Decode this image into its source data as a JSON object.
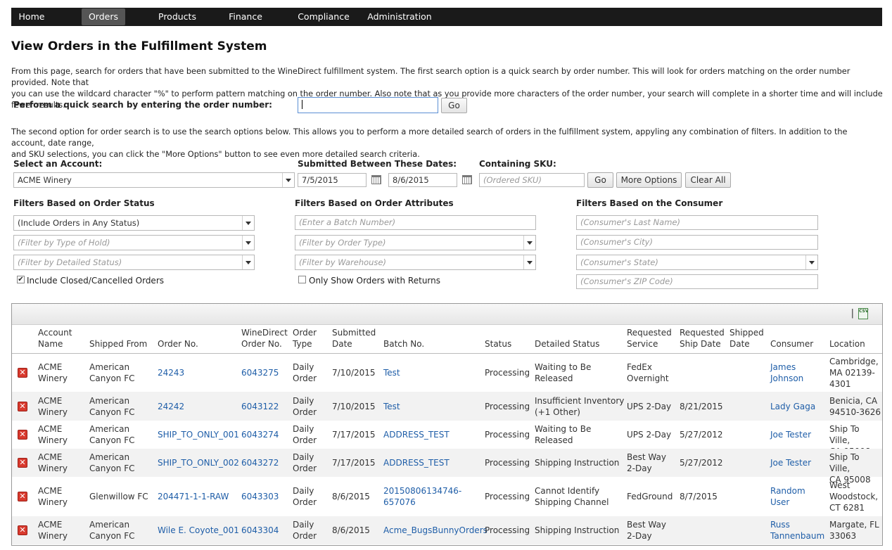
{
  "nav": {
    "items": [
      {
        "label": "Home"
      },
      {
        "label": "Orders"
      },
      {
        "label": "Products"
      },
      {
        "label": "Finance"
      },
      {
        "label": "Compliance"
      },
      {
        "label": "Administration"
      }
    ],
    "active": "Orders"
  },
  "page": {
    "title": "View Orders in the Fulfillment System",
    "intro_line1": "From this page, search for orders that have been submitted to the WineDirect fulfillment system. The first search option is a quick search by order number. This will look for orders matching on the order number provided. Note that",
    "intro_line2": "you can use the wildcard character \"%\" to perform pattern matching on the order number. Also note that as you provide more characters of the order number, your search will complete in a shorter time and will include fewer results.",
    "intro2_line1": "The second option for order search is to use the search options below. This allows you to perform a more detailed search of orders in the fulfillment system, appyling any combination of filters. In addition to the account, date range,",
    "intro2_line2": "and SKU selections, you can click the \"More Options\" button to see even more detailed search criteria."
  },
  "quick_search": {
    "label": "Perform a quick search by entering the order number:",
    "value": "",
    "go_label": "Go"
  },
  "search": {
    "account_label": "Select an Account:",
    "account_value": "ACME Winery",
    "dates_label": "Submitted Between These Dates:",
    "date_from": "7/5/2015",
    "date_to": "8/6/2015",
    "sku_label": "Containing SKU:",
    "sku_placeholder": "(Ordered SKU)",
    "go_label": "Go",
    "more_options_label": "More Options",
    "clear_all_label": "Clear All"
  },
  "filters": {
    "status": {
      "heading": "Filters Based on Order Status",
      "order_status": "(Include Orders in Any Status)",
      "hold_type_placeholder": "(Filter by Type of Hold)",
      "detailed_status_placeholder": "(Filter by Detailed Status)",
      "include_closed_label": "Include Closed/Cancelled Orders",
      "include_closed_checked": true
    },
    "attributes": {
      "heading": "Filters Based on Order Attributes",
      "batch_placeholder": "(Enter a Batch Number)",
      "order_type_placeholder": "(Filter by Order Type)",
      "warehouse_placeholder": "(Filter by Warehouse)",
      "returns_label": "Only Show Orders with Returns",
      "returns_checked": false
    },
    "consumer": {
      "heading": "Filters Based on the Consumer",
      "last_name_placeholder": "(Consumer's Last Name)",
      "city_placeholder": "(Consumer's City)",
      "state_placeholder": "(Consumer's State)",
      "zip_placeholder": "(Consumer's ZIP Code)"
    }
  },
  "grid": {
    "toolbar_separator": "|",
    "export_icon_text": "CSV",
    "headers": {
      "account_name": [
        "Account",
        "Name"
      ],
      "shipped_from": [
        "",
        "Shipped From"
      ],
      "order_no": [
        "",
        "Order No."
      ],
      "winedirect_order_no": [
        "WineDirect",
        "Order No."
      ],
      "order_type": [
        "Order",
        "Type"
      ],
      "submitted_date": [
        "Submitted",
        "Date"
      ],
      "batch_no": [
        "",
        "Batch No."
      ],
      "status": [
        "",
        "Status"
      ],
      "detailed_status": [
        "",
        "Detailed Status"
      ],
      "requested_service": [
        "Requested",
        "Service"
      ],
      "requested_ship_date": [
        "Requested",
        "Ship Date"
      ],
      "shipped_date": [
        "Shipped",
        "Date"
      ],
      "consumer": [
        "",
        "Consumer"
      ],
      "location": [
        "",
        "Location"
      ]
    },
    "rows": [
      {
        "account": [
          "ACME",
          "Winery"
        ],
        "shipped_from": [
          "American",
          "Canyon FC"
        ],
        "order_no": [
          "24243"
        ],
        "wd_order_no": [
          "6043275"
        ],
        "order_type": [
          "Daily",
          "Order"
        ],
        "submitted": [
          "7/10/2015"
        ],
        "batch": [
          "Test"
        ],
        "status": [
          "Processing"
        ],
        "detailed_status": [
          "Waiting to Be",
          "Released"
        ],
        "service": [
          "FedEx",
          "Overnight"
        ],
        "ship_date": [
          ""
        ],
        "shipped_date": [
          ""
        ],
        "consumer": [
          "James",
          "Johnson"
        ],
        "location": [
          "Cambridge,",
          "MA 02139-",
          "4301"
        ]
      },
      {
        "account": [
          "ACME",
          "Winery"
        ],
        "shipped_from": [
          "American",
          "Canyon FC"
        ],
        "order_no": [
          "24242"
        ],
        "wd_order_no": [
          "6043122"
        ],
        "order_type": [
          "Daily",
          "Order"
        ],
        "submitted": [
          "7/10/2015"
        ],
        "batch": [
          "Test"
        ],
        "status": [
          "Processing"
        ],
        "detailed_status": [
          "Insufficient Inventory",
          "(+1 Other)"
        ],
        "service": [
          "UPS 2-Day"
        ],
        "ship_date": [
          "8/21/2015"
        ],
        "shipped_date": [
          ""
        ],
        "consumer": [
          "Lady Gaga"
        ],
        "location": [
          "Benicia, CA",
          "94510-3626"
        ]
      },
      {
        "account": [
          "ACME",
          "Winery"
        ],
        "shipped_from": [
          "American",
          "Canyon FC"
        ],
        "order_no": [
          "SHIP_TO_ONLY_001"
        ],
        "wd_order_no": [
          "6043274"
        ],
        "order_type": [
          "Daily",
          "Order"
        ],
        "submitted": [
          "7/17/2015"
        ],
        "batch": [
          "ADDRESS_TEST"
        ],
        "status": [
          "Processing"
        ],
        "detailed_status": [
          "Waiting to Be",
          "Released"
        ],
        "service": [
          "UPS 2-Day"
        ],
        "ship_date": [
          "5/27/2012"
        ],
        "shipped_date": [
          ""
        ],
        "consumer": [
          "Joe Tester"
        ],
        "location": [
          "Ship To Ville,",
          "CA 95008"
        ]
      },
      {
        "account": [
          "ACME",
          "Winery"
        ],
        "shipped_from": [
          "American",
          "Canyon FC"
        ],
        "order_no": [
          "SHIP_TO_ONLY_002"
        ],
        "wd_order_no": [
          "6043272"
        ],
        "order_type": [
          "Daily",
          "Order"
        ],
        "submitted": [
          "7/17/2015"
        ],
        "batch": [
          "ADDRESS_TEST"
        ],
        "status": [
          "Processing"
        ],
        "detailed_status": [
          "Shipping Instruction"
        ],
        "service": [
          "Best Way",
          "2-Day"
        ],
        "ship_date": [
          "5/27/2012"
        ],
        "shipped_date": [
          ""
        ],
        "consumer": [
          "Joe Tester"
        ],
        "location": [
          "Ship To Ville,",
          "CA 95008"
        ]
      },
      {
        "account": [
          "ACME",
          "Winery"
        ],
        "shipped_from": [
          "Glenwillow FC"
        ],
        "order_no": [
          "204471-1-1-RAW"
        ],
        "wd_order_no": [
          "6043303"
        ],
        "order_type": [
          "Daily",
          "Order"
        ],
        "submitted": [
          "8/6/2015"
        ],
        "batch": [
          "20150806134746-",
          "657076"
        ],
        "status": [
          "Processing"
        ],
        "detailed_status": [
          "Cannot Identify",
          "Shipping Channel"
        ],
        "service": [
          "FedGround"
        ],
        "ship_date": [
          "8/7/2015"
        ],
        "shipped_date": [
          ""
        ],
        "consumer": [
          "Random",
          "User"
        ],
        "location": [
          "West",
          "Woodstock,",
          "CT 6281"
        ]
      },
      {
        "account": [
          "ACME",
          "Winery"
        ],
        "shipped_from": [
          "American",
          "Canyon FC"
        ],
        "order_no": [
          "Wile E. Coyote_001"
        ],
        "wd_order_no": [
          "6043304"
        ],
        "order_type": [
          "Daily",
          "Order"
        ],
        "submitted": [
          "8/6/2015"
        ],
        "batch": [
          "Acme_BugsBunnyOrders"
        ],
        "status": [
          "Processing"
        ],
        "detailed_status": [
          "Shipping Instruction"
        ],
        "service": [
          "Best Way",
          "2-Day"
        ],
        "ship_date": [
          ""
        ],
        "shipped_date": [
          ""
        ],
        "consumer": [
          "Russ",
          "Tannenbaum"
        ],
        "location": [
          "Margate, FL",
          "33063"
        ]
      }
    ]
  },
  "colors": {
    "nav_bg": "#1a1a1a",
    "nav_active": "#555555",
    "link": "#1f5ea8",
    "delete_icon": "#d83a2e",
    "row_alt": "#f2f2f2"
  }
}
